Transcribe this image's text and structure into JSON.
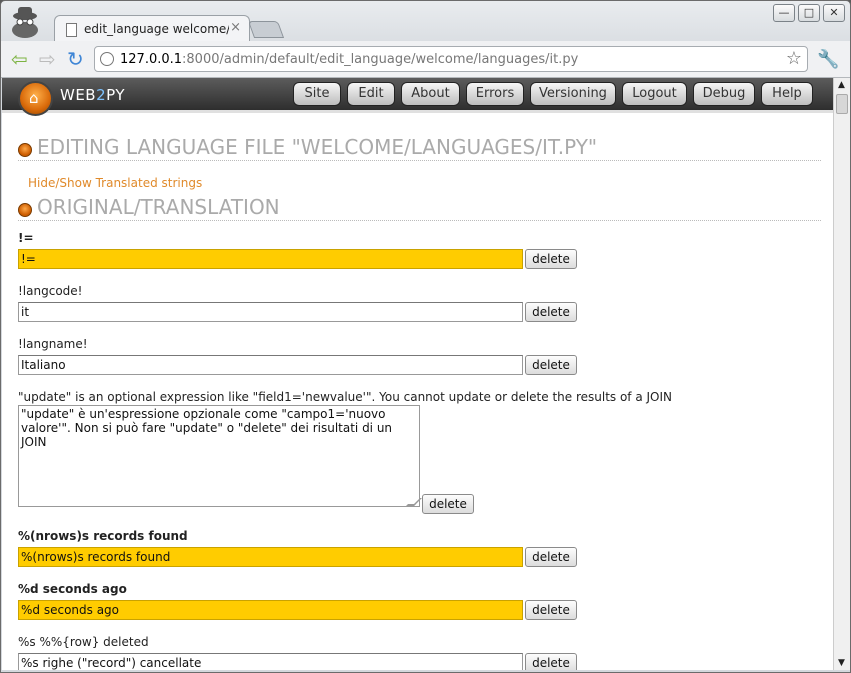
{
  "browser": {
    "tab_title": "edit_language welcome/lan",
    "tab_close": "×",
    "url_host": "127.0.0.1",
    "url_rest": ":8000/admin/default/edit_language/welcome/languages/it.py",
    "window_buttons": [
      "—",
      "□",
      "✕"
    ]
  },
  "app": {
    "logo_a": "WEB",
    "logo_b": "2",
    "logo_c": "PY",
    "menu": [
      "Site",
      "Edit",
      "About",
      "Errors",
      "Versioning",
      "Logout",
      "Debug",
      "Help"
    ]
  },
  "page": {
    "title": "EDITING LANGUAGE FILE \"WELCOME/LANGUAGES/IT.PY\"",
    "toggle_link": "Hide/Show Translated strings",
    "section_title": "ORIGINAL/TRANSLATION",
    "delete_label": "delete",
    "entries": [
      {
        "original": "!=",
        "translation": "!=",
        "untranslated": true
      },
      {
        "original": "!langcode!",
        "translation": "it",
        "untranslated": false
      },
      {
        "original": "!langname!",
        "translation": "Italiano",
        "untranslated": false
      },
      {
        "original": "\"update\" is an optional expression like \"field1='newvalue'\". You cannot update or delete the results of a JOIN",
        "translation": "\"update\" è un'espressione opzionale come \"campo1='nuovo valore'\". Non si può fare \"update\" o \"delete\" dei risultati di un JOIN",
        "untranslated": false
      },
      {
        "original": "%(nrows)s records found",
        "translation": "%(nrows)s records found",
        "untranslated": true
      },
      {
        "original": "%d seconds ago",
        "translation": "%d seconds ago",
        "untranslated": true
      },
      {
        "original": "%s %%{row} deleted",
        "translation": "%s righe (\"record\") cancellate",
        "untranslated": false
      }
    ]
  },
  "colors": {
    "untranslated_bg": "#ffcc00",
    "accent_orange": "#e08a2b",
    "header_dark": "#2e2e2e"
  }
}
